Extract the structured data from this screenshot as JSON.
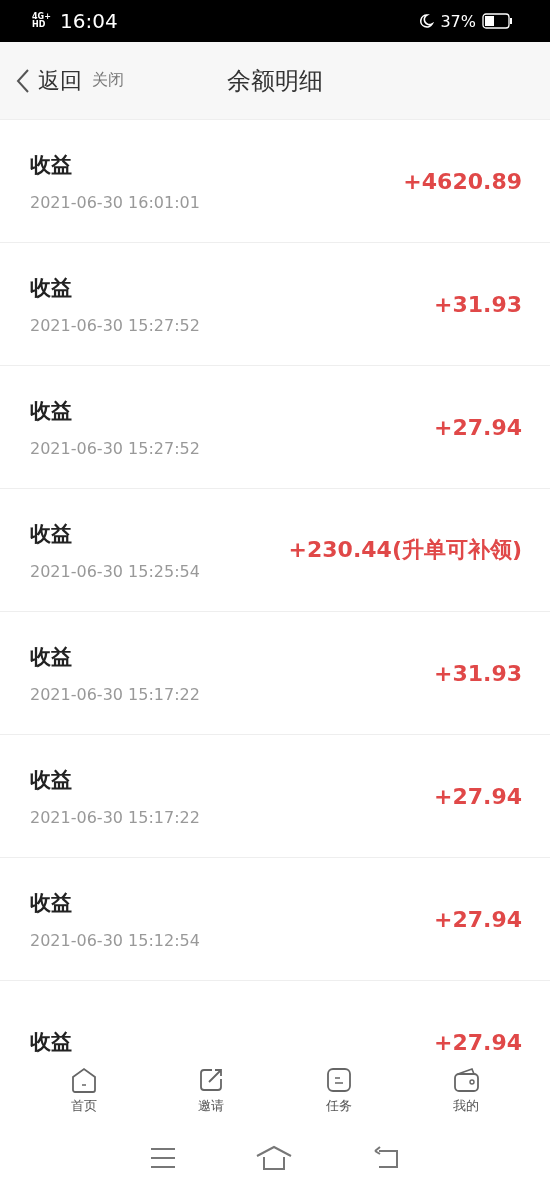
{
  "status_bar": {
    "network": "4G+HD",
    "time": "16:04",
    "battery": "37%"
  },
  "header": {
    "back": "返回",
    "close": "关闭",
    "title": "余额明细"
  },
  "entries": [
    {
      "title": "收益",
      "date": "2021-06-30 16:01:01",
      "amount": "+4620.89"
    },
    {
      "title": "收益",
      "date": "2021-06-30 15:27:52",
      "amount": "+31.93"
    },
    {
      "title": "收益",
      "date": "2021-06-30 15:27:52",
      "amount": "+27.94"
    },
    {
      "title": "收益",
      "date": "2021-06-30 15:25:54",
      "amount": "+230.44(升单可补领)"
    },
    {
      "title": "收益",
      "date": "2021-06-30 15:17:22",
      "amount": "+31.93"
    },
    {
      "title": "收益",
      "date": "2021-06-30 15:17:22",
      "amount": "+27.94"
    },
    {
      "title": "收益",
      "date": "2021-06-30 15:12:54",
      "amount": "+27.94"
    },
    {
      "title": "收益",
      "amount": "+27.94"
    }
  ],
  "tabs": [
    {
      "kind": "home",
      "label": "首页"
    },
    {
      "kind": "invite",
      "label": "邀请"
    },
    {
      "kind": "task",
      "label": "任务"
    },
    {
      "kind": "wallet",
      "label": "我的"
    }
  ]
}
